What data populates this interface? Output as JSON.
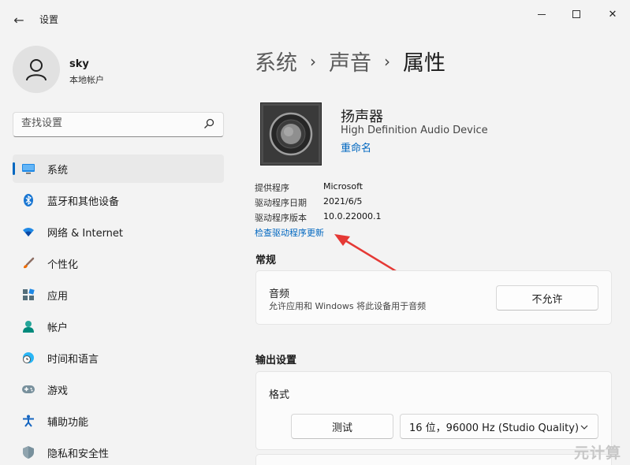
{
  "window": {
    "back_glyph": "←",
    "title": "设置",
    "close_glyph": "✕"
  },
  "user": {
    "name": "sky",
    "account_type": "本地帐户"
  },
  "search": {
    "placeholder": "查找设置"
  },
  "sidebar": {
    "items": [
      {
        "label": "系统",
        "icon": "system-icon",
        "active": true
      },
      {
        "label": "蓝牙和其他设备",
        "icon": "bluetooth-icon"
      },
      {
        "label": "网络 & Internet",
        "icon": "wifi-icon"
      },
      {
        "label": "个性化",
        "icon": "brush-icon"
      },
      {
        "label": "应用",
        "icon": "apps-icon"
      },
      {
        "label": "帐户",
        "icon": "account-icon"
      },
      {
        "label": "时间和语言",
        "icon": "clock-globe-icon"
      },
      {
        "label": "游戏",
        "icon": "gamepad-icon"
      },
      {
        "label": "辅助功能",
        "icon": "accessibility-icon"
      },
      {
        "label": "隐私和安全性",
        "icon": "shield-icon"
      }
    ]
  },
  "breadcrumb": {
    "items": [
      "系统",
      "声音",
      "属性"
    ],
    "separator": "›"
  },
  "device": {
    "name": "扬声器",
    "description": "High Definition Audio Device",
    "rename_label": "重命名"
  },
  "driver": {
    "rows": [
      {
        "key": "提供程序",
        "value": "Microsoft"
      },
      {
        "key": "驱动程序日期",
        "value": "2021/6/5"
      },
      {
        "key": "驱动程序版本",
        "value": "10.0.22000.1"
      }
    ],
    "update_link": "检查驱动程序更新"
  },
  "general": {
    "heading": "常规",
    "audio_title": "音频",
    "audio_desc": "允许应用和 Windows 将此设备用于音频",
    "disallow_label": "不允许"
  },
  "output": {
    "heading": "输出设置",
    "format_label": "格式",
    "test_label": "测试",
    "format_value": "16 位，96000 Hz (Studio Quality)"
  },
  "watermark": "元计算",
  "colors": {
    "accent": "#0067c0",
    "arrow": "#e53935"
  }
}
